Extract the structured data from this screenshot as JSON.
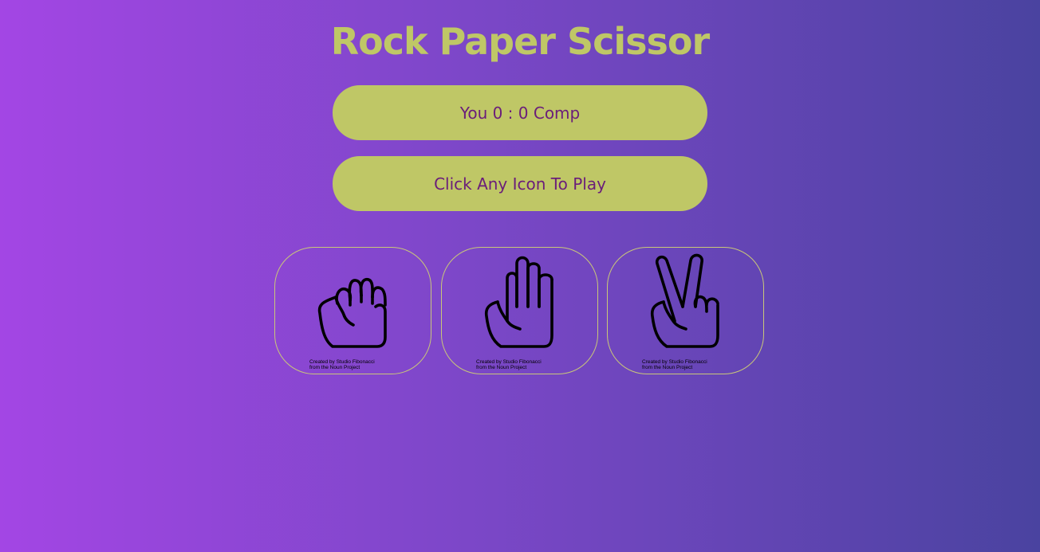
{
  "title": "Rock Paper Scissor",
  "score": {
    "text": "You 0 : 0 Comp"
  },
  "message": "Click Any Icon To Play",
  "choices": [
    {
      "name": "rock",
      "icon": "rock-hand-icon",
      "credit_line1": "Created by Studio Fibonacci",
      "credit_line2": "from the Noun Project"
    },
    {
      "name": "paper",
      "icon": "paper-hand-icon",
      "credit_line1": "Created by Studio Fibonacci",
      "credit_line2": "from the Noun Project"
    },
    {
      "name": "scissors",
      "icon": "scissors-hand-icon",
      "credit_line1": "Created by Studio Fibonacci",
      "credit_line2": "from the Noun Project"
    }
  ],
  "colors": {
    "accent": "#bfc766",
    "pill_text": "#6a1d7a",
    "title": "#bfc766",
    "choice_border": "#c9c779",
    "bg_left": "#a346e4",
    "bg_right": "#4a43a0"
  }
}
